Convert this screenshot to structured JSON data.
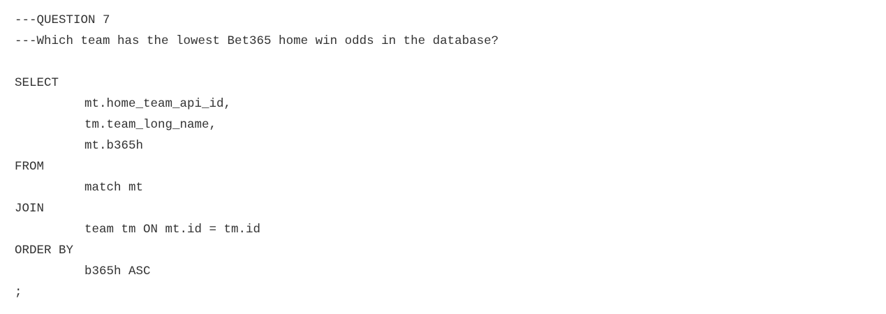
{
  "editor": {
    "lines": [
      "---QUESTION 7",
      "---Which team has the lowest Bet365 home win odds in the database?",
      "",
      "SELECT",
      "mt.home_team_api_id,",
      "tm.team_long_name,",
      "mt.b365h",
      "FROM",
      "match mt",
      "JOIN",
      "team tm ON mt.id = tm.id",
      "ORDER BY",
      "b365h ASC",
      ";"
    ]
  },
  "colors": {
    "background": "#ffffff",
    "text": "#333333"
  }
}
